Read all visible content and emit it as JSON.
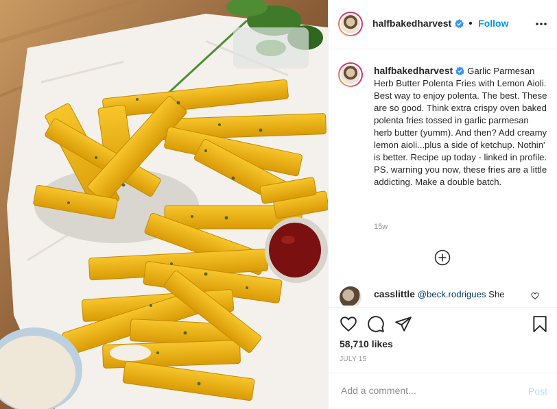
{
  "post": {
    "image": {
      "description_icon": "food-photo",
      "accent_colors": {
        "fries": "#f2b705",
        "ketchup": "#7a1010",
        "aioli": "#efe8d8",
        "paper": "#f4f1ec"
      }
    },
    "header": {
      "username": "halfbakedharvest",
      "verified": true,
      "separator": "•",
      "follow_label": "Follow",
      "more_icon": "more-horizontal-icon"
    },
    "caption": {
      "username": "halfbakedharvest",
      "text": "Garlic Parmesan Herb Butter Polenta Fries with Lemon Aioli. Best way to enjoy polenta. The best. These are so good. Think extra crispy oven baked polenta fries tossed in garlic parmesan herb butter (yumm). And then? Add creamy lemon aioli...plus a side of ketchup. Nothin' is better. Recipe up today - linked in profile. PS. warning you now, these fries are a little addicting. Make a double batch.",
      "time": "15w"
    },
    "load_more_icon": "plus-circle-icon",
    "comment": {
      "username": "casslittle",
      "mention": "@beck.rodrigues",
      "text": "She"
    },
    "actions": {
      "like_icon": "heart-icon",
      "comment_icon": "comment-icon",
      "share_icon": "share-icon",
      "save_icon": "bookmark-icon"
    },
    "likes": "58,710 likes",
    "date": "JULY 15",
    "add_comment": {
      "placeholder": "Add a comment...",
      "post_label": "Post"
    },
    "colors": {
      "link_blue": "#0095f6",
      "post_disabled": "#b2dffc",
      "muted": "#8e8e8e",
      "text": "#262626"
    }
  }
}
